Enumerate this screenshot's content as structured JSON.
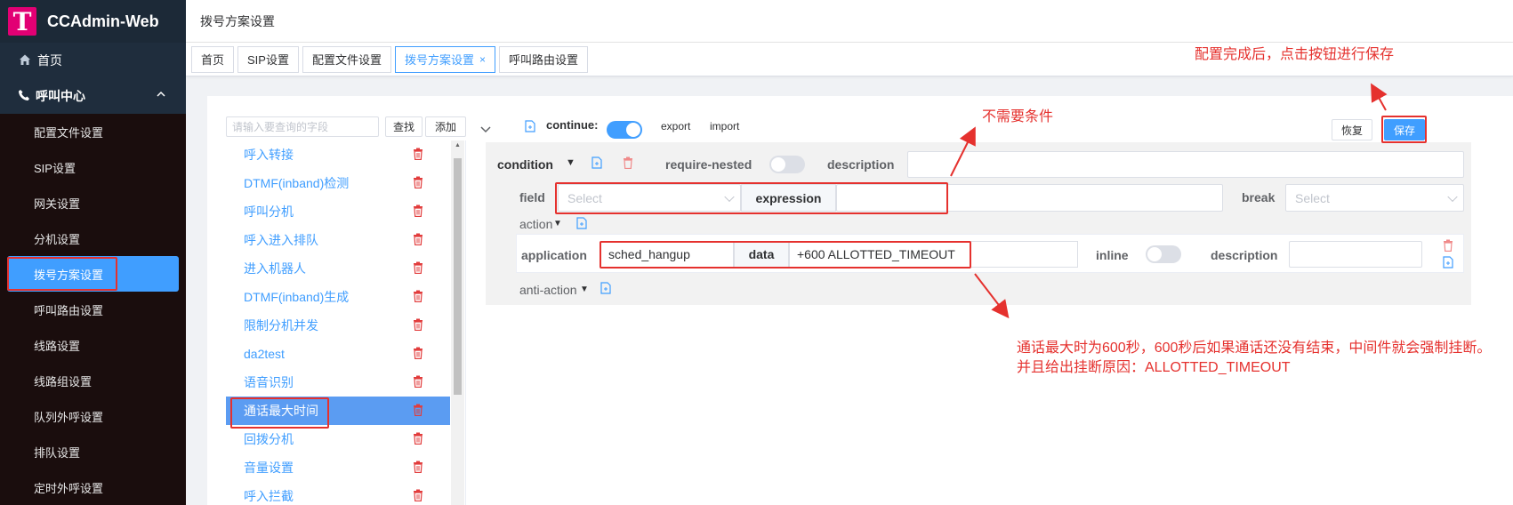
{
  "brand": {
    "logo_letter": "T",
    "title": "CCAdmin-Web",
    "logo_color": "#e20074"
  },
  "sidebar": {
    "home": "首页",
    "group": "呼叫中心",
    "items": [
      {
        "label": "配置文件设置"
      },
      {
        "label": "SIP设置"
      },
      {
        "label": "网关设置"
      },
      {
        "label": "分机设置"
      },
      {
        "label": "拨号方案设置"
      },
      {
        "label": "呼叫路由设置"
      },
      {
        "label": "线路设置"
      },
      {
        "label": "线路组设置"
      },
      {
        "label": "队列外呼设置"
      },
      {
        "label": "排队设置"
      },
      {
        "label": "定时外呼设置"
      }
    ],
    "active_index": 4
  },
  "breadcrumb": "拨号方案设置",
  "tabs": [
    {
      "label": "首页"
    },
    {
      "label": "SIP设置"
    },
    {
      "label": "配置文件设置"
    },
    {
      "label": "拨号方案设置",
      "close": "×"
    },
    {
      "label": "呼叫路由设置"
    }
  ],
  "list_panel": {
    "search_placeholder": "请输入要查询的字段",
    "search_button": "查找",
    "add_button": "添加",
    "items": [
      "呼入转接",
      "DTMF(inband)检测",
      "呼叫分机",
      "呼入进入排队",
      "进入机器人",
      "DTMF(inband)生成",
      "限制分机并发",
      "da2test",
      "语音识别",
      "通话最大时间",
      "回拨分机",
      "音量设置",
      "呼入拦截"
    ],
    "selected_index": 9
  },
  "config": {
    "continue_label": "continue:",
    "export": "export",
    "import": "import",
    "restore_button": "恢复",
    "save_button": "保存",
    "condition": {
      "label": "condition",
      "require_nested": "require-nested",
      "description": "description",
      "field": "field",
      "field_placeholder": "Select",
      "expression": "expression",
      "break": "break",
      "break_placeholder": "Select",
      "action": "action",
      "anti_action": "anti-action"
    },
    "action_row": {
      "application": "application",
      "application_value": "sched_hangup",
      "data": "data",
      "data_value": "+600 ALLOTTED_TIMEOUT",
      "inline": "inline",
      "description": "description"
    }
  },
  "annotations": {
    "save_hint": "配置完成后，点击按钮进行保存",
    "no_condition": "不需要条件",
    "timeout_line1": "通话最大时为600秒，600秒后如果通话还没有结束，中间件就会强制挂断。",
    "timeout_line2": "并且给出挂断原因：ALLOTTED_TIMEOUT"
  },
  "colors": {
    "accent": "#409eff",
    "annotation": "#e5312e",
    "delete": "#e23c3c"
  }
}
